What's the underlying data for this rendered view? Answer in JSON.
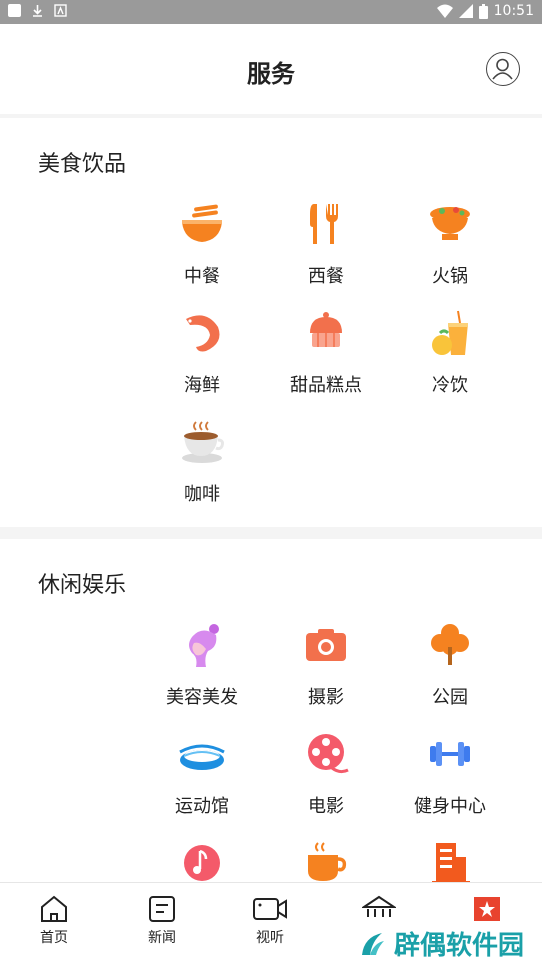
{
  "status_bar": {
    "time": "10:51"
  },
  "header": {
    "title": "服务"
  },
  "sections": [
    {
      "title": "美食饮品",
      "items": [
        {
          "label": "中餐",
          "icon": "noodle-bowl-icon"
        },
        {
          "label": "西餐",
          "icon": "fork-knife-icon"
        },
        {
          "label": "火锅",
          "icon": "hotpot-icon"
        },
        {
          "label": "海鲜",
          "icon": "shrimp-icon"
        },
        {
          "label": "甜品糕点",
          "icon": "cupcake-icon"
        },
        {
          "label": "冷饮",
          "icon": "cold-drink-icon"
        },
        {
          "label": "咖啡",
          "icon": "coffee-cup-icon"
        }
      ]
    },
    {
      "title": "休闲娱乐",
      "items": [
        {
          "label": "美容美发",
          "icon": "beauty-hair-icon"
        },
        {
          "label": "摄影",
          "icon": "camera-icon"
        },
        {
          "label": "公园",
          "icon": "tree-icon"
        },
        {
          "label": "运动馆",
          "icon": "stadium-icon"
        },
        {
          "label": "电影",
          "icon": "film-reel-icon"
        },
        {
          "label": "健身中心",
          "icon": "dumbbell-icon"
        },
        {
          "label": "",
          "icon": "music-icon"
        },
        {
          "label": "",
          "icon": "teacup-icon"
        },
        {
          "label": "",
          "icon": "building-icon"
        }
      ]
    }
  ],
  "tabbar": {
    "tabs": [
      {
        "label": "首页",
        "icon": "home-icon"
      },
      {
        "label": "新闻",
        "icon": "news-icon"
      },
      {
        "label": "视听",
        "icon": "video-icon"
      },
      {
        "label": "",
        "icon": "government-icon"
      },
      {
        "label": "",
        "icon": "star-badge-icon"
      }
    ]
  },
  "watermark": {
    "text": "辟偶软件园"
  },
  "colors": {
    "orange": "#F58220",
    "coral": "#F2704C",
    "pink": "#F45A6A",
    "blue": "#3E7BEE",
    "teal": "#1AA0A8"
  }
}
